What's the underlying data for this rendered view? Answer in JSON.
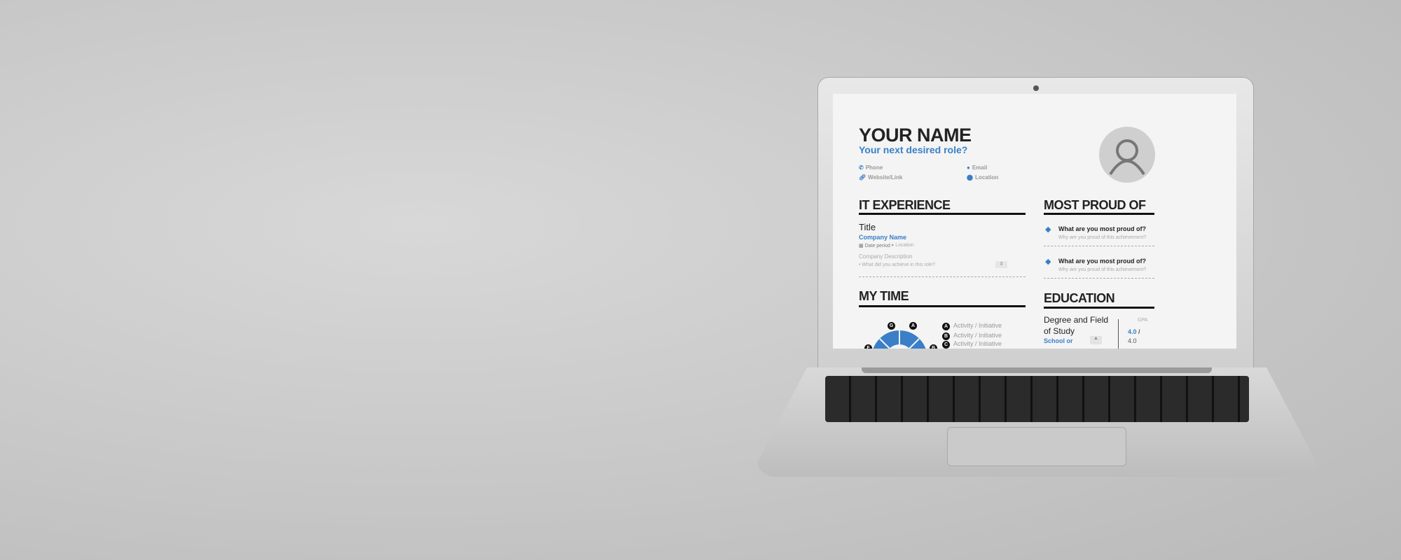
{
  "resume": {
    "name": "YOUR NAME",
    "role": "Your next desired role?",
    "contact": {
      "phone": "Phone",
      "website": "Website/Link",
      "email": "Email",
      "location": "Location"
    },
    "experience": {
      "heading": "IT EXPERIENCE",
      "title": "Title",
      "company": "Company Name",
      "date": "Date period",
      "location": "Location",
      "description": "Company Description",
      "bullet": "What did you achieve in this role?"
    },
    "proud": {
      "heading": "MOST PROUD OF",
      "items": [
        {
          "q": "What are you most proud of?",
          "a": "Why are you proud of this achievement?"
        },
        {
          "q": "What are you most proud of?",
          "a": "Why are you proud of this achievement?"
        }
      ]
    },
    "time": {
      "heading": "MY TIME",
      "labels": [
        "G",
        "A",
        "F",
        "B"
      ],
      "legend": [
        {
          "key": "A",
          "label": "Activity / Initiative"
        },
        {
          "key": "B",
          "label": "Activity / Initiative"
        },
        {
          "key": "C",
          "label": "Activity / Initiative"
        }
      ]
    },
    "education": {
      "heading": "EDUCATION",
      "degree": "Degree and Field of Study",
      "school": "School or",
      "gpa_label": "GPA",
      "gpa": "4.0",
      "gpa_sep": "/",
      "gpa_max": "4.0"
    }
  },
  "colors": {
    "accent": "#3a7fc8"
  }
}
